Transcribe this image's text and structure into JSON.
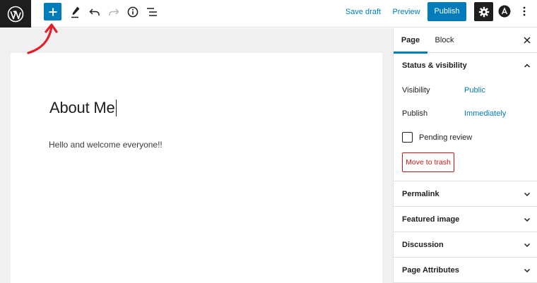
{
  "toolbar": {
    "save_draft": "Save draft",
    "preview": "Preview",
    "publish": "Publish"
  },
  "post": {
    "title": "About Me",
    "paragraph": "Hello and welcome everyone!!"
  },
  "sidebar": {
    "tabs": [
      "Page",
      "Block"
    ],
    "status_panel": {
      "title": "Status & visibility",
      "visibility_label": "Visibility",
      "visibility_value": "Public",
      "publish_label": "Publish",
      "publish_value": "Immediately",
      "pending_review": "Pending review",
      "pending_checked": false,
      "trash": "Move to trash"
    },
    "panels": [
      "Permalink",
      "Featured image",
      "Discussion",
      "Page Attributes"
    ]
  },
  "colors": {
    "accent": "#007cba",
    "danger": "#cc1818",
    "annotation": "#e0202a",
    "dark": "#1e1e1e"
  },
  "icons": [
    "wordpress-logo-icon",
    "plus-icon",
    "pen-icon",
    "undo-icon",
    "redo-icon",
    "info-icon",
    "list-view-icon",
    "gear-icon",
    "plugin-icon",
    "more-vertical-icon",
    "close-icon",
    "chevron-up-icon",
    "chevron-down-icon"
  ]
}
